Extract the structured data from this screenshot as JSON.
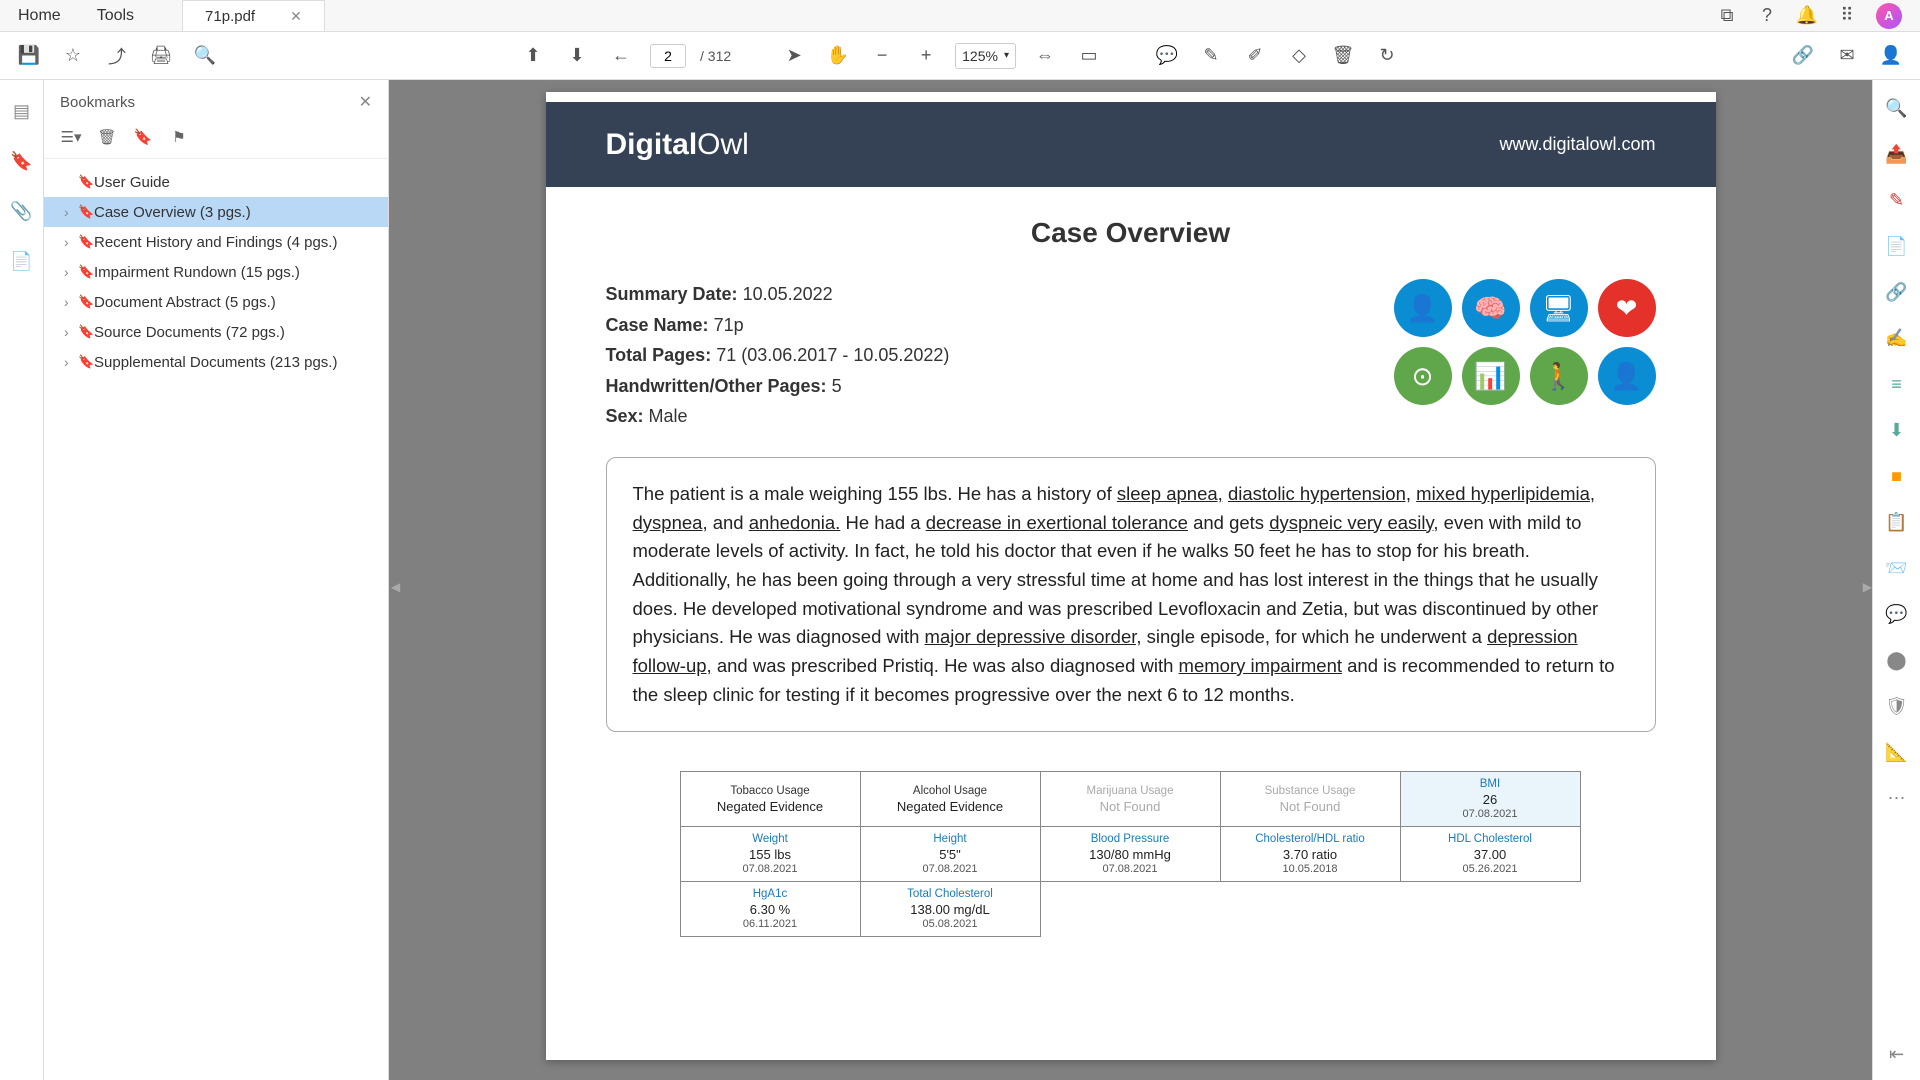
{
  "tabs": {
    "home": "Home",
    "tools": "Tools",
    "file_name": "71p.pdf"
  },
  "toolbar": {
    "page_current": "2",
    "page_total": "/ 312",
    "zoom": "125%"
  },
  "bookmarks": {
    "title": "Bookmarks",
    "items": [
      {
        "label": "User Guide",
        "expandable": false
      },
      {
        "label": "Case Overview (3 pgs.)",
        "expandable": true,
        "selected": true
      },
      {
        "label": "Recent History and Findings (4 pgs.)",
        "expandable": true
      },
      {
        "label": "Impairment Rundown (15 pgs.)",
        "expandable": true
      },
      {
        "label": "Document Abstract (5 pgs.)",
        "expandable": true
      },
      {
        "label": "Source Documents (72 pgs.)",
        "expandable": true
      },
      {
        "label": "Supplemental Documents (213 pgs.)",
        "expandable": true
      }
    ]
  },
  "doc": {
    "logo_bold": "Digital",
    "logo_light": "Owl",
    "url": "www.digitalowl.com",
    "title": "Case Overview",
    "meta": {
      "summary_date_label": "Summary Date:",
      "summary_date": "10.05.2022",
      "case_name_label": "Case Name:",
      "case_name": "71p",
      "total_pages_label": "Total Pages:",
      "total_pages": "71 (03.06.2017 - 10.05.2022)",
      "handwritten_label": "Handwritten/Other Pages:",
      "handwritten": "5",
      "sex_label": "Sex:",
      "sex": "Male"
    },
    "summary_parts": {
      "p1": "The patient is a male weighing 155 lbs. He has a history of ",
      "u1": "sleep apnea,",
      "sp1": " ",
      "u2": "diastolic hypertension,",
      "sp2": " ",
      "u3": "mixed hyperlipidemia,",
      "sp3": " ",
      "u4": "dyspnea,",
      "p2": " and ",
      "u5": "anhedonia.",
      "p3": " He had a ",
      "u6": "decrease in exertional tolerance",
      "p4": " and gets ",
      "u7": "dyspneic very easily,",
      "p5": " even with mild to moderate levels of activity. In fact, he told his doctor that even if he walks 50 feet he has to stop for his breath. Additionally, he has been going through a very stressful time at home and has lost interest in the things that he usually does. He developed motivational syndrome and was prescribed Levofloxacin and Zetia, but was discontinued by other physicians. He was diagnosed with ",
      "u8": "major depressive disorder,",
      "p6": " single episode, for which he underwent a ",
      "u9": "depression follow-up,",
      "p7": " and was prescribed Pristiq. He was also diagnosed with ",
      "u10": "memory impairment",
      "p8": " and is recommended to return to the sleep clinic for testing if it becomes progressive over the next 6 to 12 months."
    },
    "metrics": {
      "r1": [
        {
          "label": "Tobacco Usage",
          "val": "Negated Evidence"
        },
        {
          "label": "Alcohol Usage",
          "val": "Negated Evidence"
        },
        {
          "label": "Marijuana Usage",
          "val": "Not Found",
          "gray": true
        },
        {
          "label": "Substance Usage",
          "val": "Not Found",
          "gray": true
        },
        {
          "label": "BMI",
          "val": "26",
          "date": "07.08.2021",
          "link": true,
          "bmi": true
        }
      ],
      "r2": [
        {
          "label": "Weight",
          "val": "155 lbs",
          "date": "07.08.2021",
          "link": true
        },
        {
          "label": "Height",
          "val": "5'5\"",
          "date": "07.08.2021",
          "link": true
        },
        {
          "label": "Blood Pressure",
          "val": "130/80 mmHg",
          "date": "07.08.2021",
          "link": true
        },
        {
          "label": "Cholesterol/HDL ratio",
          "val": "3.70 ratio",
          "date": "10.05.2018",
          "link": true
        },
        {
          "label": "HDL Cholesterol",
          "val": "37.00",
          "date": "05.26.2021",
          "link": true
        }
      ],
      "r3": [
        {
          "label": "HgA1c",
          "val": "6.30 %",
          "date": "06.11.2021",
          "link": true
        },
        {
          "label": "Total Cholesterol",
          "val": "138.00 mg/dL",
          "date": "05.08.2021",
          "link": true
        }
      ]
    }
  }
}
